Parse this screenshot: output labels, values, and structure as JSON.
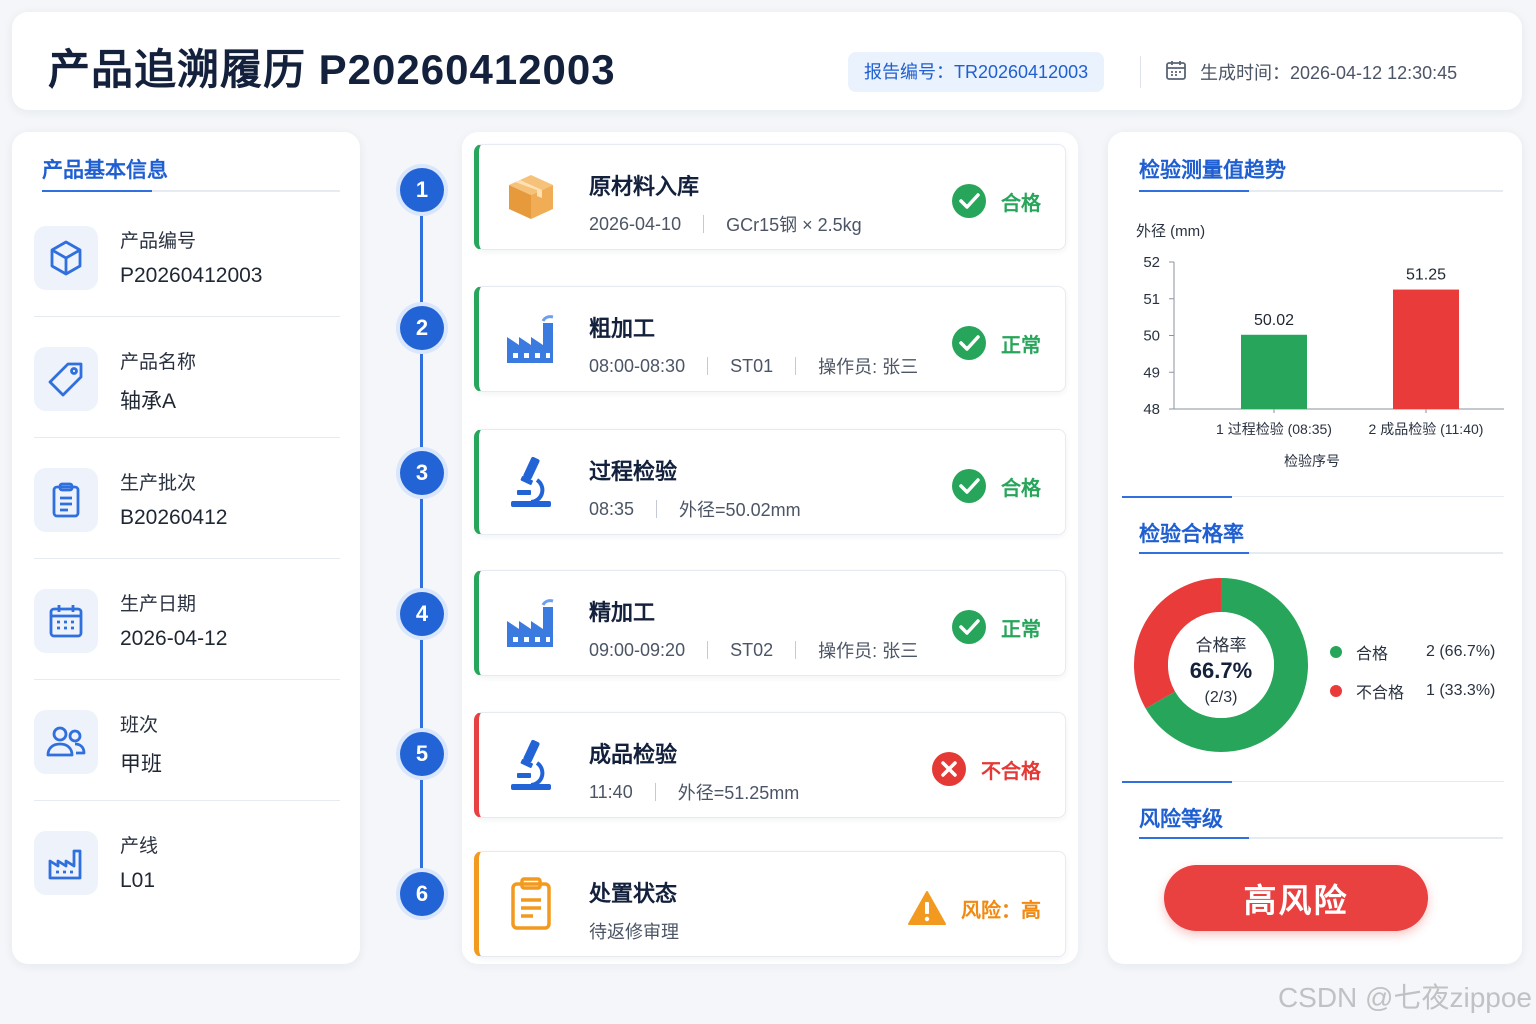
{
  "header": {
    "title": "产品追溯履历 P20260412003",
    "report_no": "报告编号：TR20260412003",
    "gen_time": "生成时间：2026-04-12 12:30:45"
  },
  "info": {
    "section_title": "产品基本信息",
    "items": [
      {
        "icon": "cube-icon",
        "label": "产品编号",
        "value": "P20260412003"
      },
      {
        "icon": "tag-icon",
        "label": "产品名称",
        "value": "轴承A"
      },
      {
        "icon": "clipboard-icon",
        "label": "生产批次",
        "value": "B20260412"
      },
      {
        "icon": "calendar-icon",
        "label": "生产日期",
        "value": "2026-04-12"
      },
      {
        "icon": "users-icon",
        "label": "班次",
        "value": "甲班"
      },
      {
        "icon": "factory-icon",
        "label": "产线",
        "value": "L01"
      }
    ]
  },
  "timeline": [
    {
      "num": "1",
      "icon": "box-icon",
      "name": "原材料入库",
      "details": [
        "2026-04-10",
        "GCr15钢 × 2.5kg"
      ],
      "status": "合格",
      "status_type": "ok"
    },
    {
      "num": "2",
      "icon": "factory-icon",
      "name": "粗加工",
      "details": [
        "08:00-08:30",
        "ST01",
        "操作员: 张三"
      ],
      "status": "正常",
      "status_type": "ok"
    },
    {
      "num": "3",
      "icon": "microscope-icon",
      "name": "过程检验",
      "details": [
        "08:35",
        "外径=50.02mm"
      ],
      "status": "合格",
      "status_type": "ok"
    },
    {
      "num": "4",
      "icon": "factory-icon",
      "name": "精加工",
      "details": [
        "09:00-09:20",
        "ST02",
        "操作员: 张三"
      ],
      "status": "正常",
      "status_type": "ok"
    },
    {
      "num": "5",
      "icon": "microscope-icon",
      "name": "成品检验",
      "details": [
        "11:40",
        "外径=51.25mm"
      ],
      "status": "不合格",
      "status_type": "fail"
    },
    {
      "num": "6",
      "icon": "clipboard-icon",
      "name": "处置状态",
      "details": [
        "待返修审理"
      ],
      "status": "风险：高",
      "status_type": "warn"
    }
  ],
  "trend": {
    "section_title": "检验测量值趋势"
  },
  "chart_data": [
    {
      "type": "bar",
      "title": "检验测量值趋势",
      "ylabel": "外径 (mm)",
      "xlabel": "检验序号",
      "categories": [
        "1 过程检验 (08:35)",
        "2 成品检验 (11:40)"
      ],
      "values": [
        50.02,
        51.25
      ],
      "value_labels": [
        "50.02",
        "51.25"
      ],
      "colors": [
        "#27a55a",
        "#ea3b3b"
      ],
      "ylim": [
        48,
        52
      ],
      "yticks": [
        "48",
        "49",
        "50",
        "51",
        "52"
      ]
    },
    {
      "type": "pie",
      "title": "检验合格率",
      "center_label": "合格率",
      "center_value": "66.7%",
      "center_sub": "(2/3)",
      "slices": [
        {
          "name": "合格",
          "value": 2,
          "label": "2 (66.7%)",
          "color": "#27a55a"
        },
        {
          "name": "不合格",
          "value": 1,
          "label": "1 (33.3%)",
          "color": "#ea3b3b"
        }
      ]
    }
  ],
  "rate": {
    "section_title": "检验合格率"
  },
  "risk": {
    "section_title": "风险等级",
    "level": "高风险"
  },
  "watermark": "CSDN @七夜zippoe"
}
